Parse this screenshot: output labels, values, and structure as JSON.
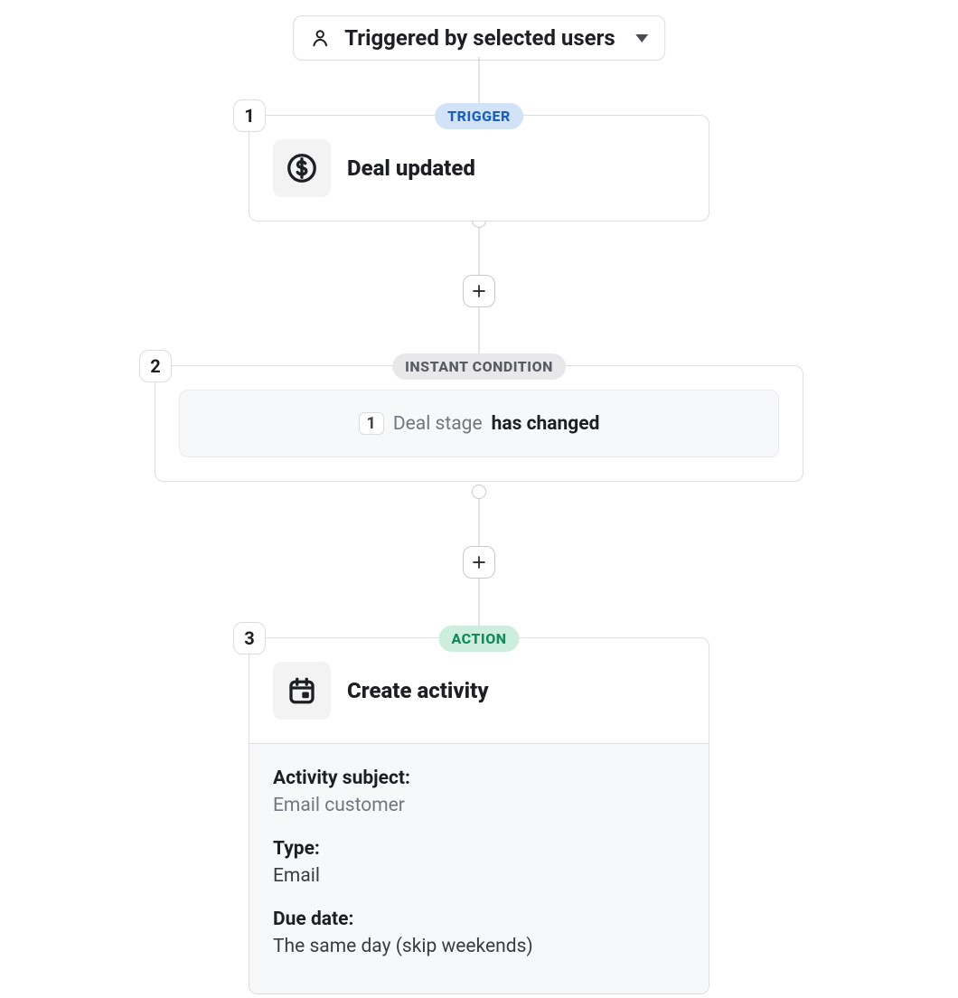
{
  "triggeredBy": {
    "label": "Triggered by selected users"
  },
  "steps": [
    {
      "num": "1",
      "pill": "TRIGGER",
      "pill_variant": "blue",
      "title": "Deal updated",
      "icon": "dollar-circle-icon"
    },
    {
      "num": "2",
      "pill": "INSTANT CONDITION",
      "pill_variant": "gray",
      "condition": {
        "ref": "1",
        "field": "Deal stage",
        "op": "has changed"
      }
    },
    {
      "num": "3",
      "pill": "ACTION",
      "pill_variant": "green",
      "title": "Create activity",
      "icon": "calendar-icon",
      "details": [
        {
          "label": "Activity subject:",
          "value": "Email customer",
          "muted": true
        },
        {
          "label": "Type:",
          "value": "Email",
          "muted": false
        },
        {
          "label": "Due date:",
          "value": "The same day (skip weekends)",
          "muted": false
        }
      ]
    }
  ]
}
